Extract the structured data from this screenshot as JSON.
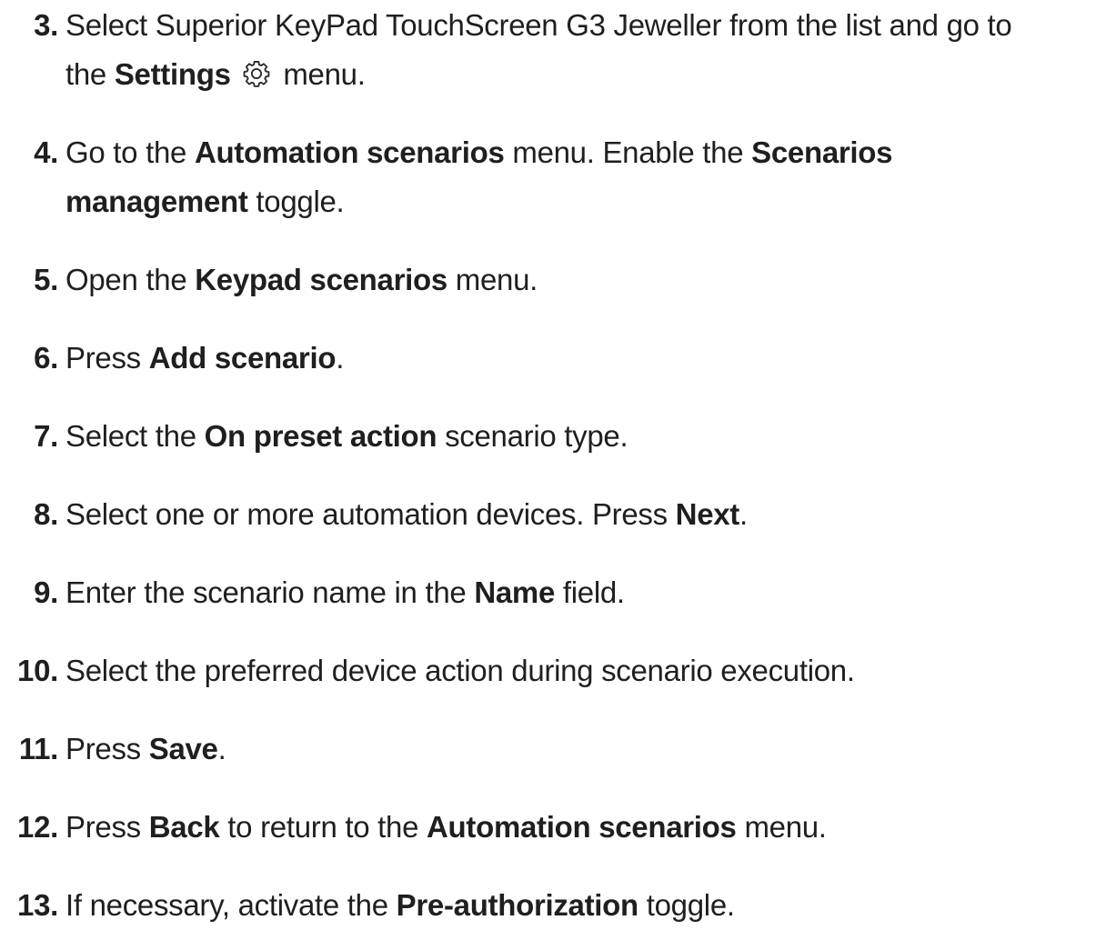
{
  "steps": [
    {
      "number": "3.",
      "pre": "Select Superior KeyPad TouchScreen G3 Jeweller from the list and go to",
      "line2a": "the ",
      "bold1": "Settings",
      "line2b": " menu.",
      "icon": "gear-icon"
    },
    {
      "number": "4.",
      "pre": "Go to the ",
      "bold1": "Automation scenarios",
      "mid": " menu. Enable the ",
      "bold2": "Scenarios",
      "bold3": "management",
      "post": " toggle."
    },
    {
      "number": "5.",
      "pre": "Open the ",
      "bold1": "Keypad scenarios",
      "post": " menu."
    },
    {
      "number": "6.",
      "pre": "Press ",
      "bold1": "Add scenario",
      "post": "."
    },
    {
      "number": "7.",
      "pre": "Select the ",
      "bold1": "On preset action",
      "post": " scenario type."
    },
    {
      "number": "8.",
      "pre": "Select one or more automation devices. Press ",
      "bold1": "Next",
      "post": "."
    },
    {
      "number": "9.",
      "pre": "Enter the scenario name in the ",
      "bold1": "Name",
      "post": " field."
    },
    {
      "number": "10.",
      "pre": "Select the preferred device action during scenario execution."
    },
    {
      "number": "11.",
      "pre": "Press ",
      "bold1": "Save",
      "post": "."
    },
    {
      "number": "12.",
      "pre": "Press ",
      "bold1": "Back",
      "mid": " to return to the ",
      "bold2": "Automation scenarios",
      "post": " menu."
    },
    {
      "number": "13.",
      "pre": "If necessary, activate the ",
      "bold1": "Pre-authorization",
      "post": " toggle."
    }
  ]
}
